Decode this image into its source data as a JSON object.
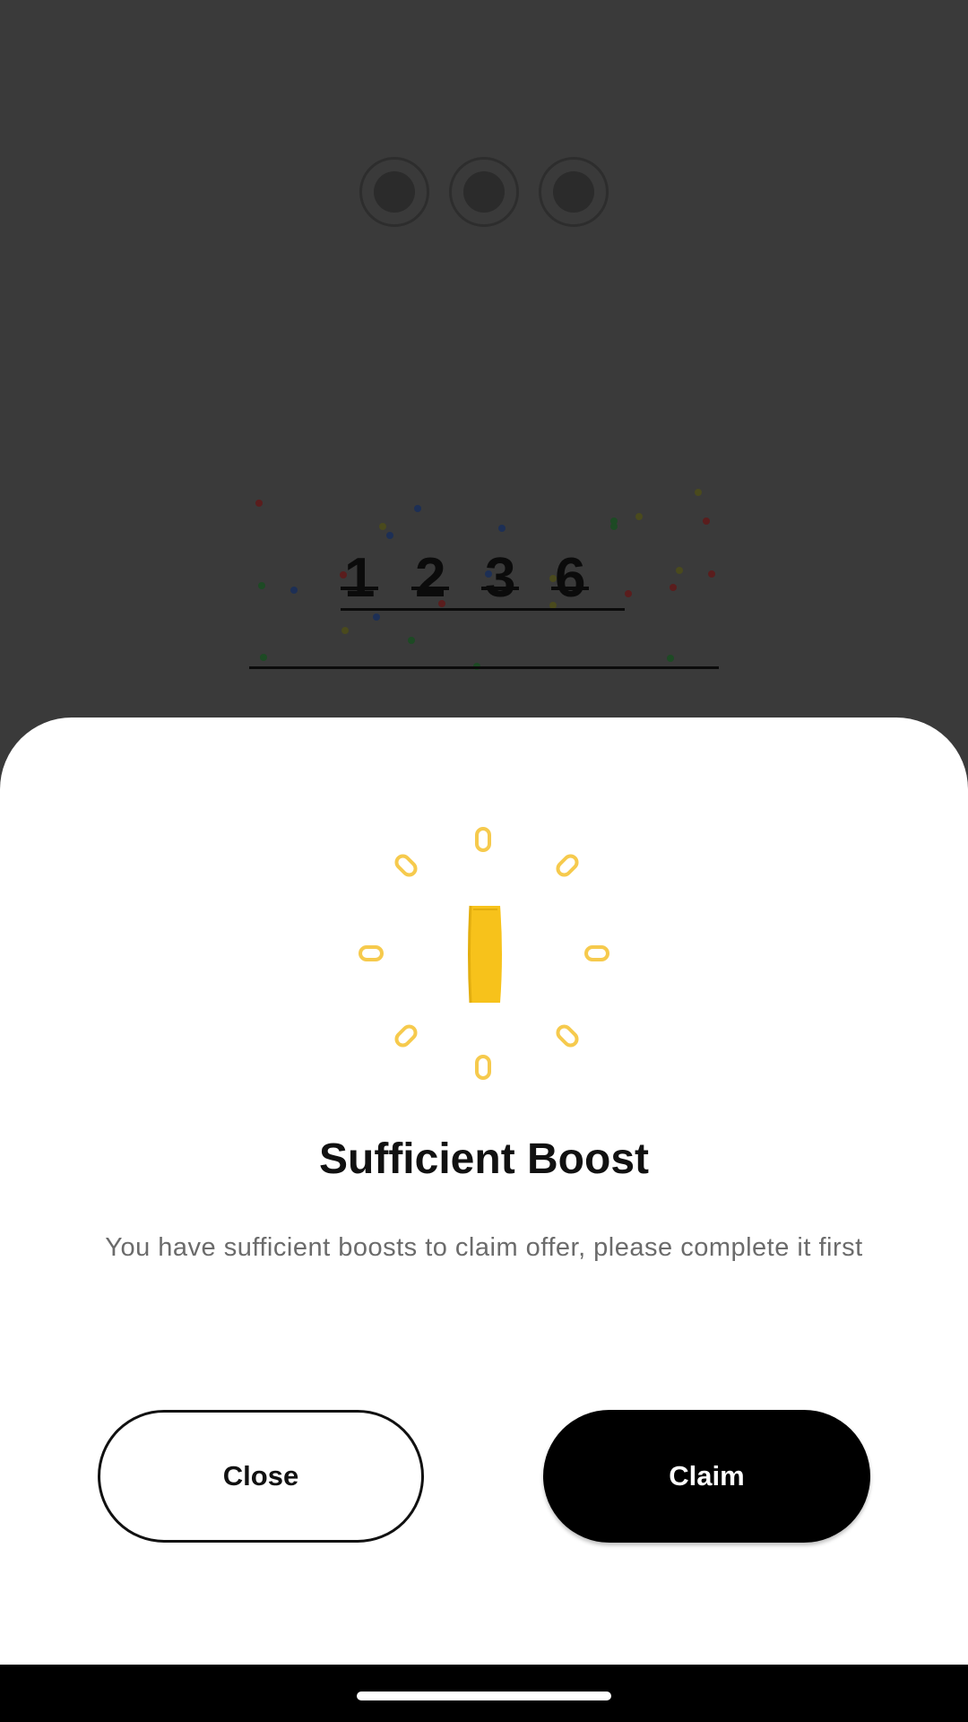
{
  "background": {
    "digits": [
      "1",
      "2",
      "3",
      "6"
    ]
  },
  "sheet": {
    "illustration_icon": "boost-coin-sparkle-icon",
    "title": "Sufficient Boost",
    "subtitle": "You have sufficient boosts to claim offer, please complete it first",
    "close_label": "Close",
    "claim_label": "Claim"
  },
  "colors": {
    "accent_gold": "#F5C12E",
    "overlay": "#3a3a3a",
    "primary_button": "#000000"
  }
}
